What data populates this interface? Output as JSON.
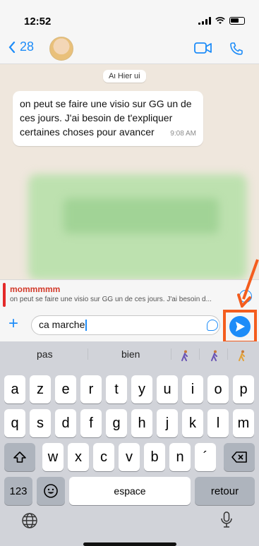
{
  "status_bar": {
    "time": "12:52"
  },
  "header": {
    "back_count": "28"
  },
  "chat": {
    "date_label": "Aι Hier ui",
    "message": {
      "lines": [
        "on peut se faire une visio sur GG un de",
        "ces jours. J'ai besoin de t'expliquer",
        "certaines choses pour avancer"
      ],
      "time": "9:08 AM"
    }
  },
  "reply": {
    "name": "mommmmm",
    "text": "on peut se faire une visio sur GG un de ces jours. J'ai besoin d..."
  },
  "input": {
    "value": "ca marche"
  },
  "keyboard": {
    "suggestions": [
      "pas",
      "bien"
    ],
    "row1": [
      "a",
      "z",
      "e",
      "r",
      "t",
      "y",
      "u",
      "i",
      "o",
      "p"
    ],
    "row2": [
      "q",
      "s",
      "d",
      "f",
      "g",
      "h",
      "j",
      "k",
      "l",
      "m"
    ],
    "row3": [
      "w",
      "x",
      "c",
      "v",
      "b",
      "n",
      "´"
    ],
    "numbers_label": "123",
    "space_label": "espace",
    "return_label": "retour"
  },
  "colors": {
    "accent": "#1d8cf8",
    "highlight": "#f45d1e",
    "reply_name": "#d23a2a"
  }
}
